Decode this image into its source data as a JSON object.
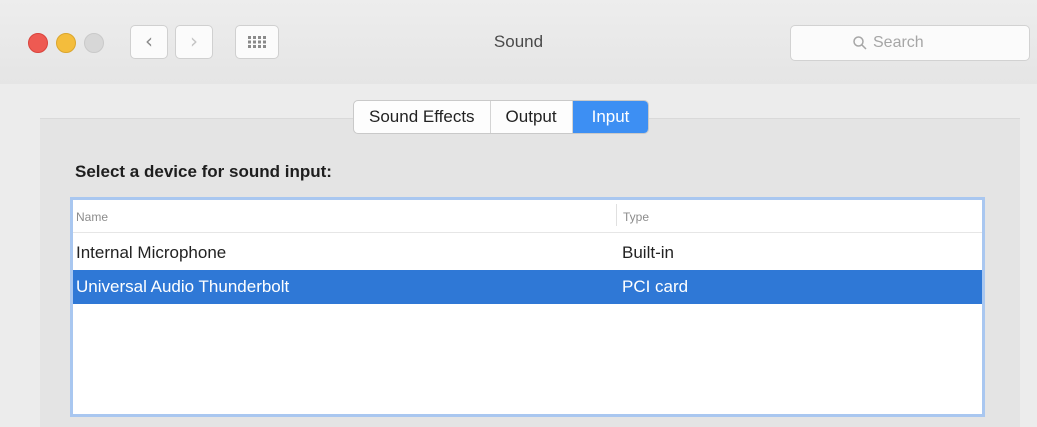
{
  "window": {
    "title": "Sound"
  },
  "toolbar": {
    "back_glyph": "‹",
    "forward_glyph": "›",
    "grid_icon": "show-all-grid-icon"
  },
  "search": {
    "placeholder": "Search"
  },
  "tabs": [
    {
      "label": "Sound Effects",
      "active": false
    },
    {
      "label": "Output",
      "active": false
    },
    {
      "label": "Input",
      "active": true
    }
  ],
  "input_section": {
    "prompt": "Select a device for sound input:",
    "columns": {
      "name": "Name",
      "type": "Type"
    },
    "devices": [
      {
        "name": "Internal Microphone",
        "type": "Built-in",
        "selected": false
      },
      {
        "name": "Universal Audio Thunderbolt",
        "type": "PCI card",
        "selected": true
      }
    ]
  },
  "colors": {
    "accent": "#3d8ff3",
    "selection": "#2f78d6",
    "close": "#ee5a52",
    "minimize": "#f4bd3c"
  }
}
